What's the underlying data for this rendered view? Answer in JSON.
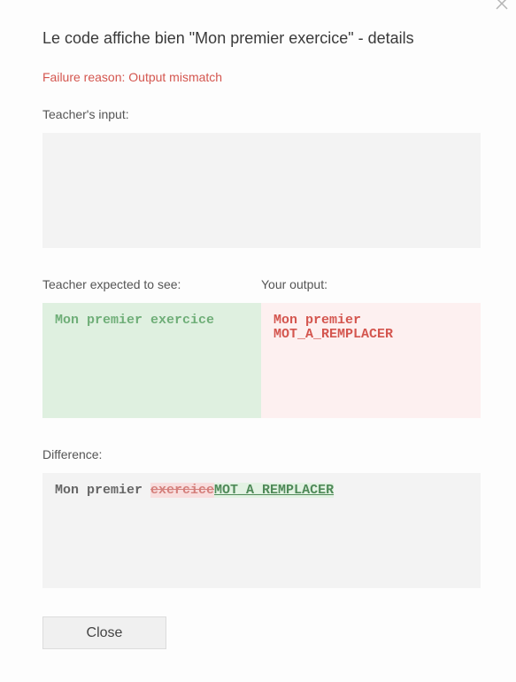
{
  "modal": {
    "title": "Le code affiche bien \"Mon premier exercice\" - details",
    "failure_reason": "Failure reason: Output mismatch",
    "close_icon": "close-icon"
  },
  "teacher_input": {
    "label": "Teacher's input:",
    "value": ""
  },
  "expected": {
    "label": "Teacher expected to see:",
    "value": "Mon premier exercice"
  },
  "output": {
    "label": "Your output:",
    "value": "Mon premier\nMOT_A_REMPLACER"
  },
  "difference": {
    "label": "Difference:",
    "common": "Mon premier ",
    "removed": "exercice",
    "added": "MOT_A_REMPLACER"
  },
  "footer": {
    "close_label": "Close"
  },
  "colors": {
    "failure": "#d4564f",
    "expected_bg": "#dff0e0",
    "expected_text": "#6fae78",
    "output_bg": "#fdf0f0",
    "output_text": "#d4564f"
  }
}
